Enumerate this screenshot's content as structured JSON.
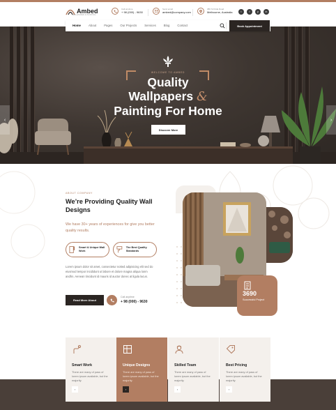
{
  "header": {
    "logo_text": "Ambed",
    "logo_tagline": "WALLPAPER & PAINTING",
    "call": {
      "label": "Call anytime",
      "value": "+ 98 (000) - 9630"
    },
    "email": {
      "label": "Send email",
      "value": "ambed@company.com"
    },
    "address": {
      "label": "380 St Kilda Road",
      "value": "Melbourne, Australia"
    },
    "socials": [
      "t",
      "f",
      "p",
      "in"
    ]
  },
  "nav": {
    "items": [
      "Home",
      "About",
      "Pages",
      "Our Projects",
      "Services",
      "Blog",
      "Contact"
    ],
    "active": "Home",
    "appointment_label": "Book Appointment"
  },
  "hero": {
    "tag": "WELCOME TO AMBED",
    "title_line1": "Quality",
    "title_line2": "Wallpapers",
    "title_amp": "&",
    "title_line3": "Painting For Home",
    "cta_label": "Discover More",
    "prev_arrow": "‹",
    "next_arrow": "›"
  },
  "about": {
    "tag": "ABOUT COMPANY",
    "title": "We’re Providing Quality Wall Designs",
    "lead": "We have 30+ years of experiences for give you better quality results.",
    "features": [
      {
        "title": "Smart & Unique Wall Work",
        "icon": "wallpaper-roll-icon"
      },
      {
        "title": "The Best Quality Standards",
        "icon": "paint-roller-icon"
      }
    ],
    "body": "Lorem ipsum dolor sit amet, consectetur notted adipisicing elit sed do eiusmod tempor incididunt ut labore et dolore magna aliqua lonm andhn. Aenean tincidunt id mauris id auctor donec at ligula lacus.",
    "read_more_label": "Read More About",
    "call_label": "Call anytime",
    "call_value": "+ 98 (000) - 9630",
    "stat_value": "3690",
    "stat_caption": "Successful Project"
  },
  "services": [
    {
      "title": "Smart Work",
      "desc": "There are many of pass of lorem ipsum available, but the majority.",
      "highlight": false,
      "icon": "brush-hand-icon"
    },
    {
      "title": "Unique Designs",
      "desc": "There are many of pass of lorem ipsum available, but the majority.",
      "highlight": true,
      "icon": "design-sheet-icon"
    },
    {
      "title": "Skilled Team",
      "desc": "There are many of pass of lorem ipsum available, but the majority.",
      "highlight": false,
      "icon": "worker-icon"
    },
    {
      "title": "Best Pricing",
      "desc": "There are many of pass of lorem ipsum available, but the majority.",
      "highlight": false,
      "icon": "price-tag-icon"
    }
  ],
  "colors": {
    "accent": "#b27e62",
    "dark": "#2b2522",
    "hero_bg": "#3a332e",
    "soft": "#f4f0ec"
  }
}
